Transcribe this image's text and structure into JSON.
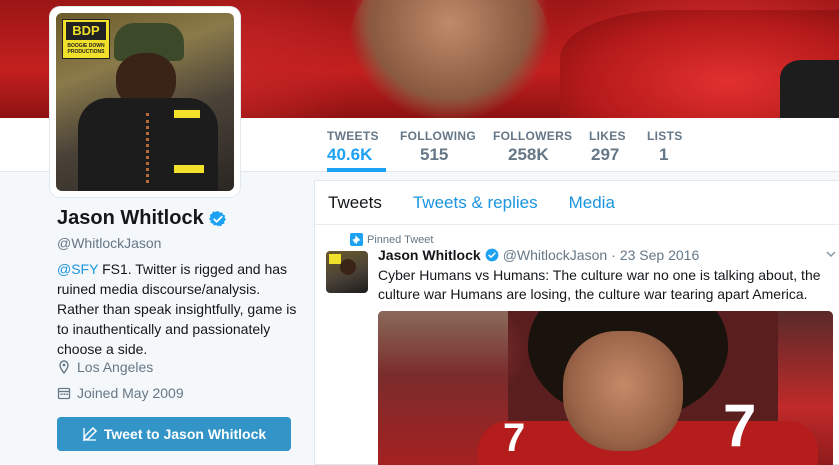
{
  "profile": {
    "name": "Jason Whitlock",
    "handle": "@WhitlockJason",
    "bio_link": "@SFY",
    "bio_text": " FS1. Twitter is rigged and has ruined media discourse/analysis. Rather than speak insightfully, game is to inauthentically and passionately choose a side.",
    "location": "Los Angeles",
    "joined": "Joined May 2009",
    "tweet_to_label": "Tweet to Jason Whitlock",
    "avatar_logo_text": "BDP",
    "avatar_logo_sub": "BOOGIE DOWN PRODUCTIONS"
  },
  "stats": [
    {
      "label": "TWEETS",
      "value": "40.6K"
    },
    {
      "label": "FOLLOWING",
      "value": "515"
    },
    {
      "label": "FOLLOWERS",
      "value": "258K"
    },
    {
      "label": "LIKES",
      "value": "297"
    },
    {
      "label": "LISTS",
      "value": "1"
    }
  ],
  "tabs": [
    "Tweets",
    "Tweets & replies",
    "Media"
  ],
  "pinned_tweet": {
    "pinned_label": "Pinned Tweet",
    "name": "Jason Whitlock",
    "handle": "@WhitlockJason",
    "separator": "·",
    "date": "23 Sep 2016",
    "text": "Cyber Humans vs Humans: The culture war no one is talking about, the culture war Humans are losing, the culture war tearing apart America.",
    "jersey_numbers": [
      "7",
      "7"
    ]
  },
  "icons": {
    "verified": "verified-badge-icon",
    "location": "map-pin-icon",
    "calendar": "calendar-icon",
    "compose": "compose-icon",
    "pin": "pin-icon",
    "caret": "chevron-down-icon"
  },
  "colors": {
    "accent": "#1da1f2",
    "link": "#1b95e0",
    "button": "#3394c7"
  }
}
